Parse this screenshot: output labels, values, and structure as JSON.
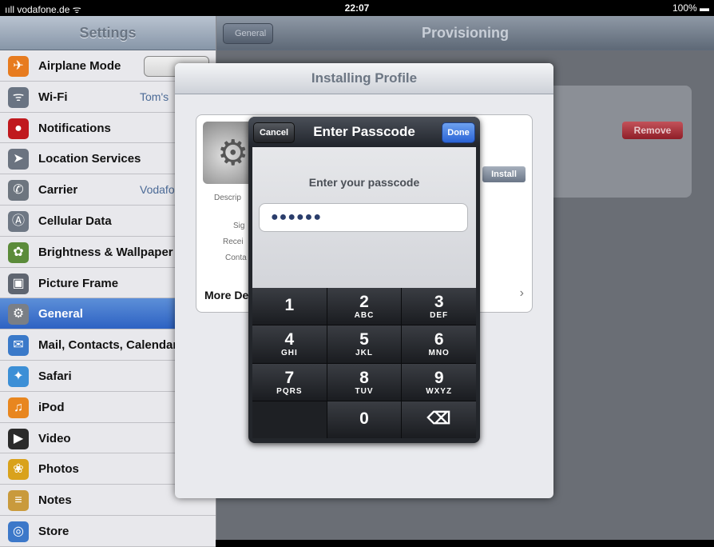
{
  "status_bar": {
    "carrier": "ııll vodafone.de ᯤ",
    "time": "22:07",
    "battery": "100% ▬"
  },
  "sidebar": {
    "title": "Settings",
    "items": [
      {
        "label": "Airplane Mode",
        "toggle": "OFF",
        "icon": "airplane-icon",
        "color": "#e77b1f"
      },
      {
        "label": "Wi-Fi",
        "value": "Tom's",
        "icon": "wifi-icon",
        "color": "#6a7483"
      },
      {
        "label": "Notifications",
        "icon": "notifications-icon",
        "color": "#c0191e"
      },
      {
        "label": "Location Services",
        "icon": "location-icon",
        "color": "#6b7380"
      },
      {
        "label": "Carrier",
        "value": "Vodafo",
        "icon": "carrier-icon",
        "color": "#6d757f"
      },
      {
        "label": "Cellular Data",
        "icon": "cellular-icon",
        "color": "#6e7784"
      },
      {
        "label": "Brightness & Wallpaper",
        "icon": "brightness-icon",
        "color": "#5b8b3a"
      },
      {
        "label": "Picture Frame",
        "icon": "picture-frame-icon",
        "color": "#5f6570"
      },
      {
        "label": "General",
        "icon": "gear-icon",
        "color": "#7a7f86",
        "selected": true
      },
      {
        "label": "Mail, Contacts, Calendars",
        "icon": "mail-icon",
        "color": "#3a79c9"
      },
      {
        "label": "Safari",
        "icon": "safari-icon",
        "color": "#3c8fd6"
      },
      {
        "label": "iPod",
        "icon": "ipod-icon",
        "color": "#e8861f"
      },
      {
        "label": "Video",
        "icon": "video-icon",
        "color": "#2b2b2b"
      },
      {
        "label": "Photos",
        "icon": "photos-icon",
        "color": "#d9a21c"
      },
      {
        "label": "Notes",
        "icon": "notes-icon",
        "color": "#c99a3c"
      },
      {
        "label": "Store",
        "icon": "store-icon",
        "color": "#3c78c9"
      }
    ]
  },
  "main": {
    "title": "Provisioning",
    "back_label": "General",
    "remove_label": "Remove"
  },
  "sheet": {
    "title": "Installing Profile",
    "install_label": "Install",
    "fields": [
      "Descrip",
      "Sig",
      "Recei",
      "Conta"
    ],
    "more_details": "More De",
    "chevron": "›"
  },
  "dialog": {
    "title": "Enter Passcode",
    "cancel": "Cancel",
    "done": "Done",
    "prompt": "Enter your passcode",
    "pin": "●●●●●●",
    "keys": [
      {
        "num": "1",
        "letters": ""
      },
      {
        "num": "2",
        "letters": "ABC"
      },
      {
        "num": "3",
        "letters": "DEF"
      },
      {
        "num": "4",
        "letters": "GHI"
      },
      {
        "num": "5",
        "letters": "JKL"
      },
      {
        "num": "6",
        "letters": "MNO"
      },
      {
        "num": "7",
        "letters": "PQRS"
      },
      {
        "num": "8",
        "letters": "TUV"
      },
      {
        "num": "9",
        "letters": "WXYZ"
      },
      {
        "num": "",
        "letters": ""
      },
      {
        "num": "0",
        "letters": ""
      },
      {
        "num": "⌫",
        "letters": ""
      }
    ]
  }
}
